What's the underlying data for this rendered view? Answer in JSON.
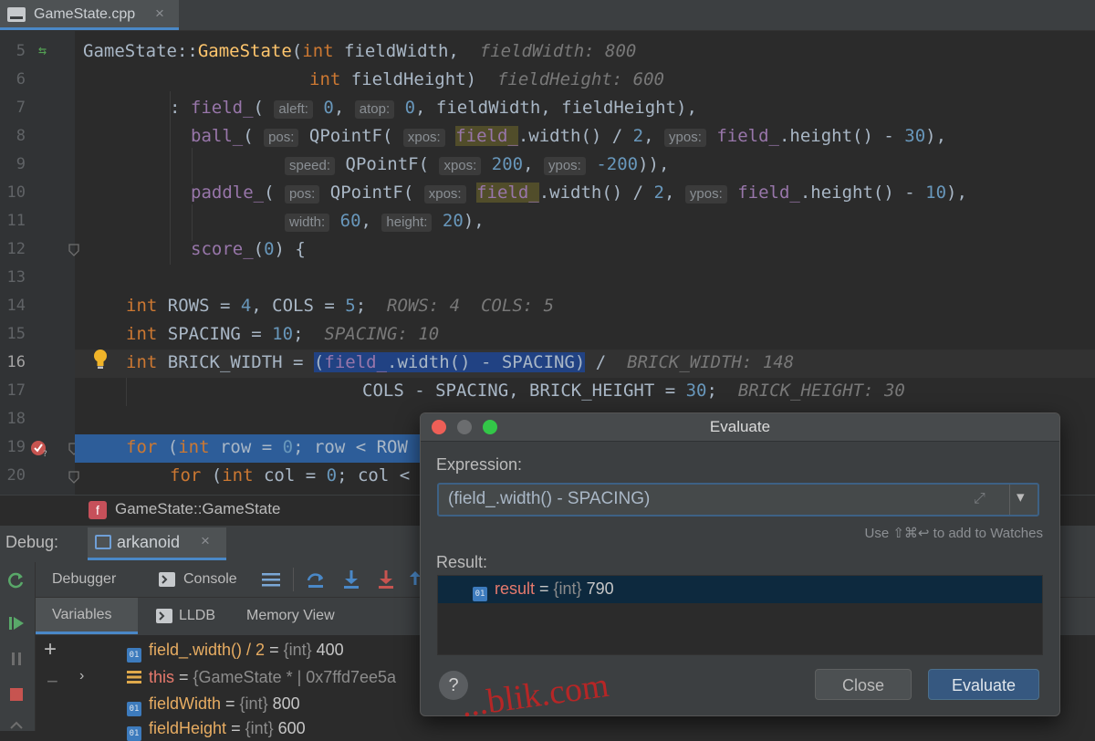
{
  "tab": {
    "file_name": "GameState.cpp",
    "close": "×"
  },
  "editor": {
    "lines": [
      {
        "n": "5"
      },
      {
        "n": "6"
      },
      {
        "n": "7"
      },
      {
        "n": "8"
      },
      {
        "n": "9"
      },
      {
        "n": "10"
      },
      {
        "n": "11"
      },
      {
        "n": "12"
      },
      {
        "n": "13"
      },
      {
        "n": "14"
      },
      {
        "n": "15"
      },
      {
        "n": "16"
      },
      {
        "n": "17"
      },
      {
        "n": "18"
      },
      {
        "n": "19"
      },
      {
        "n": "20"
      }
    ],
    "code": {
      "l5_class": "GameState",
      "l5_sep": "::",
      "l5_fn": "GameState",
      "l5_open": "(",
      "l5_int": "int",
      "l5_param": " fieldWidth,",
      "l5_hint": "fieldWidth: 800",
      "l6_int": "int",
      "l6_param": " fieldHeight)",
      "l6_hint": "fieldHeight: 600",
      "l7_pre": ": ",
      "l7_field": "field_",
      "l7_open": "( ",
      "l7_p1": "aleft:",
      "l7_v1": "0",
      "l7_c1": ", ",
      "l7_p2": "atop:",
      "l7_v2": "0",
      "l7_rest": ", fieldWidth, fieldHeight),",
      "l8_field": "ball_",
      "l8_open": "( ",
      "l8_p1": "pos:",
      "l8_fn": "QPointF",
      "l8_o2": "( ",
      "l8_p2": "xpos:",
      "l8_f2": "field_",
      "l8_m1": ".width() / ",
      "l8_v1": "2",
      "l8_c1": ", ",
      "l8_p3": "ypos:",
      "l8_f3": "field_",
      "l8_m2": ".height() - ",
      "l8_v2": "30",
      "l8_end": "),",
      "l9_p1": "speed:",
      "l9_fn": "QPointF",
      "l9_o": "( ",
      "l9_p2": "xpos:",
      "l9_v1": "200",
      "l9_c": ", ",
      "l9_p3": "ypos:",
      "l9_v2": "-200",
      "l9_end": ")),",
      "l10_field": "paddle_",
      "l10_open": "( ",
      "l10_p1": "pos:",
      "l10_fn": "QPointF",
      "l10_o2": "( ",
      "l10_p2": "xpos:",
      "l10_f2": "field_",
      "l10_m1": ".width() / ",
      "l10_v1": "2",
      "l10_c1": ", ",
      "l10_p3": "ypos:",
      "l10_f3": "field_",
      "l10_m2": ".height() - ",
      "l10_v2": "10",
      "l10_end": "),",
      "l11_p1": "width:",
      "l11_v1": "60",
      "l11_c": ", ",
      "l11_p2": "height:",
      "l11_v2": "20",
      "l11_end": "),",
      "l12_field": "score_",
      "l12_o": "(",
      "l12_v": "0",
      "l12_end": ") {",
      "l14_int": "int",
      "l14_a": " ROWS = ",
      "l14_v1": "4",
      "l14_b": ", COLS = ",
      "l14_v2": "5",
      "l14_c": ";",
      "l14_hint": "ROWS: 4  COLS: 5",
      "l15_int": "int",
      "l15_a": " SPACING = ",
      "l15_v": "10",
      "l15_c": ";",
      "l15_hint": "SPACING: 10",
      "l16_int": "int",
      "l16_a": " BRICK_WIDTH = ",
      "l16_sel_o": "(",
      "l16_sel_f": "field_",
      "l16_sel_r": ".width() - SPACING)",
      "l16_b": " /",
      "l16_hint": "BRICK_WIDTH: 148",
      "l17_a": "COLS - SPACING, BRICK_HEIGHT = ",
      "l17_v": "30",
      "l17_c": ";",
      "l17_hint": "BRICK_HEIGHT: 30",
      "l19_kw": "for",
      "l19_a": " (",
      "l19_int": "int",
      "l19_b": " row = ",
      "l19_v": "0",
      "l19_c": "; row < ROW",
      "l20_kw": "for",
      "l20_a": " (",
      "l20_int": "int",
      "l20_b": " col = ",
      "l20_v": "0",
      "l20_c": "; col <"
    }
  },
  "breadcrumb": {
    "icon_letter": "f",
    "text": "GameState::GameState"
  },
  "debug": {
    "label": "Debug:",
    "session_tab": "arkanoid",
    "session_close": "×",
    "toolbar": {
      "debugger": "Debugger",
      "console": "Console"
    },
    "subtabs": {
      "variables": "Variables",
      "lldb": "LLDB",
      "memory": "Memory View"
    },
    "variables": [
      {
        "name": "field_.width() / 2",
        "eq": " = ",
        "type": "{int}",
        "value": " 400",
        "icon": "01"
      },
      {
        "name": "this",
        "eq": " = ",
        "type": "{GameState * | 0x7ffd7ee5a",
        "value": "",
        "icon": ""
      },
      {
        "name": "fieldWidth",
        "eq": " = ",
        "type": "{int}",
        "value": " 800",
        "icon": "01"
      },
      {
        "name": "fieldHeight",
        "eq": " = ",
        "type": "{int}",
        "value": " 600",
        "icon": "01"
      }
    ]
  },
  "dialog": {
    "title": "Evaluate",
    "expression_label": "Expression:",
    "expression_value": "(field_.width() - SPACING)",
    "hint": "Use ⇧⌘↩ to add to Watches",
    "result_label": "Result:",
    "result": {
      "name": "result",
      "eq": " = ",
      "type": "{int}",
      "value": " 790"
    },
    "help": "?",
    "close": "Close",
    "evaluate": "Evaluate"
  },
  "watermark": "...blik.com",
  "colors": {
    "accent": "#4a88c7",
    "current_line": "#2d5d99",
    "keyword": "#cc7832",
    "number": "#6897bb",
    "field": "#9876aa",
    "function": "#ffc66d"
  }
}
